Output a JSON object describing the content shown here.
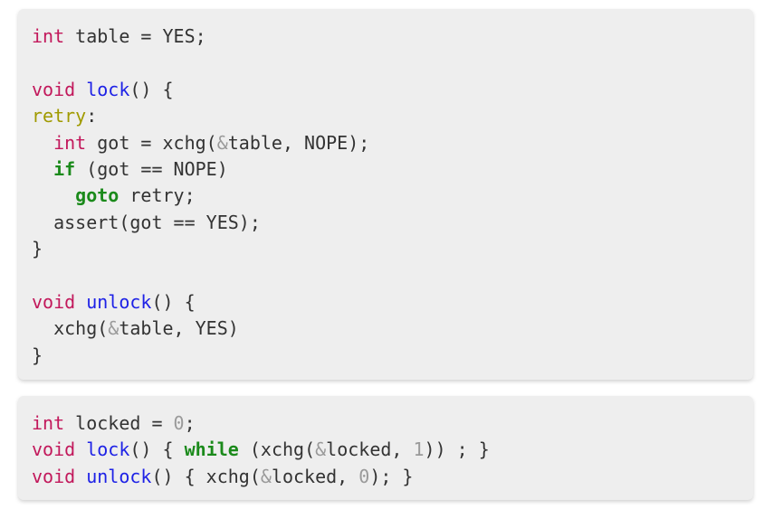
{
  "block1": {
    "lines": [
      [
        {
          "t": "int",
          "c": "type"
        },
        {
          "t": " table = YES;"
        }
      ],
      [],
      [
        {
          "t": "void",
          "c": "type"
        },
        {
          "t": " "
        },
        {
          "t": "lock",
          "c": "fn"
        },
        {
          "t": "() {"
        }
      ],
      [
        {
          "t": "retry",
          "c": "label"
        },
        {
          "t": ":"
        }
      ],
      [
        {
          "t": "  "
        },
        {
          "t": "int",
          "c": "type"
        },
        {
          "t": " got = xchg("
        },
        {
          "t": "&",
          "c": "amp"
        },
        {
          "t": "table, NOPE);"
        }
      ],
      [
        {
          "t": "  "
        },
        {
          "t": "if",
          "c": "kw"
        },
        {
          "t": " (got == NOPE)"
        }
      ],
      [
        {
          "t": "    "
        },
        {
          "t": "goto",
          "c": "kw"
        },
        {
          "t": " retry;"
        }
      ],
      [
        {
          "t": "  assert(got == YES);"
        }
      ],
      [
        {
          "t": "}"
        }
      ],
      [],
      [
        {
          "t": "void",
          "c": "type"
        },
        {
          "t": " "
        },
        {
          "t": "unlock",
          "c": "fn"
        },
        {
          "t": "() {"
        }
      ],
      [
        {
          "t": "  xchg("
        },
        {
          "t": "&",
          "c": "amp"
        },
        {
          "t": "table, YES)"
        }
      ],
      [
        {
          "t": "}"
        }
      ]
    ]
  },
  "block2": {
    "lines": [
      [
        {
          "t": "int",
          "c": "type"
        },
        {
          "t": " locked = "
        },
        {
          "t": "0",
          "c": "num"
        },
        {
          "t": ";"
        }
      ],
      [
        {
          "t": "void",
          "c": "type"
        },
        {
          "t": " "
        },
        {
          "t": "lock",
          "c": "fn"
        },
        {
          "t": "() { "
        },
        {
          "t": "while",
          "c": "kw"
        },
        {
          "t": " (xchg("
        },
        {
          "t": "&",
          "c": "amp"
        },
        {
          "t": "locked, "
        },
        {
          "t": "1",
          "c": "num"
        },
        {
          "t": ")) ; }"
        }
      ],
      [
        {
          "t": "void",
          "c": "type"
        },
        {
          "t": " "
        },
        {
          "t": "unlock",
          "c": "fn"
        },
        {
          "t": "() { xchg("
        },
        {
          "t": "&",
          "c": "amp"
        },
        {
          "t": "locked, "
        },
        {
          "t": "0",
          "c": "num"
        },
        {
          "t": "); }"
        }
      ]
    ]
  },
  "colors": {
    "type": "#c2185b",
    "function": "#1e22e6",
    "label": "#a09a00",
    "keyword": "#1b8a1b",
    "muted": "#9a9a9a",
    "text": "#333333",
    "block_background": "#eeeeee"
  }
}
